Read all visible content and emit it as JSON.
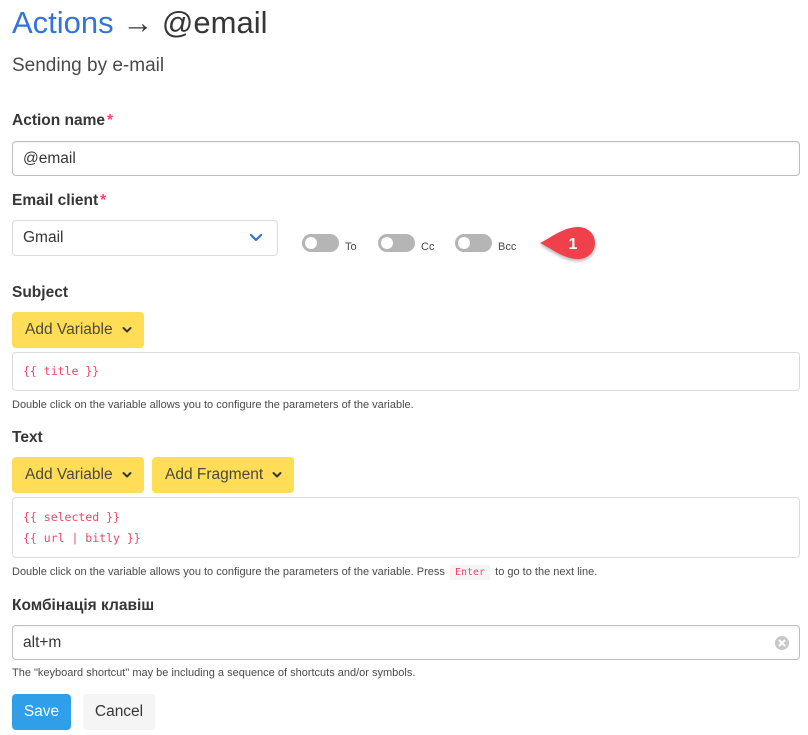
{
  "header": {
    "breadcrumb_link": "Actions",
    "arrow": "→",
    "title": "@email",
    "subtitle": "Sending by e-mail"
  },
  "form": {
    "action_name": {
      "label": "Action name",
      "required_mark": "*",
      "value": "@email"
    },
    "email_client": {
      "label": "Email client",
      "required_mark": "*",
      "selected": "Gmail",
      "toggles": [
        {
          "label": "To",
          "on": false
        },
        {
          "label": "Cc",
          "on": false
        },
        {
          "label": "Bcc",
          "on": false
        }
      ],
      "callout": "1",
      "callout_color": "#f0414b"
    },
    "subject": {
      "label": "Subject",
      "add_variable": "Add Variable",
      "lines": [
        "{{ title }}"
      ],
      "help": "Double click on the variable allows you to configure the parameters of the variable."
    },
    "text": {
      "label": "Text",
      "add_variable": "Add Variable",
      "add_fragment": "Add Fragment",
      "lines": [
        "{{ selected }}",
        "{{ url | bitly }}"
      ],
      "help_before": "Double click on the variable allows you to configure the parameters of the variable. Press",
      "help_key": "Enter",
      "help_after": "to go to the next line."
    },
    "shortcut": {
      "label": "Комбінація клавіш",
      "value": "alt+m",
      "help": "The \"keyboard shortcut\" may be including a sequence of shortcuts and/or symbols."
    },
    "buttons": {
      "save": "Save",
      "cancel": "Cancel"
    }
  },
  "colors": {
    "link": "#3273dc",
    "warning": "#ffdd57",
    "primary": "#2f9fea",
    "code": "#f14668"
  }
}
